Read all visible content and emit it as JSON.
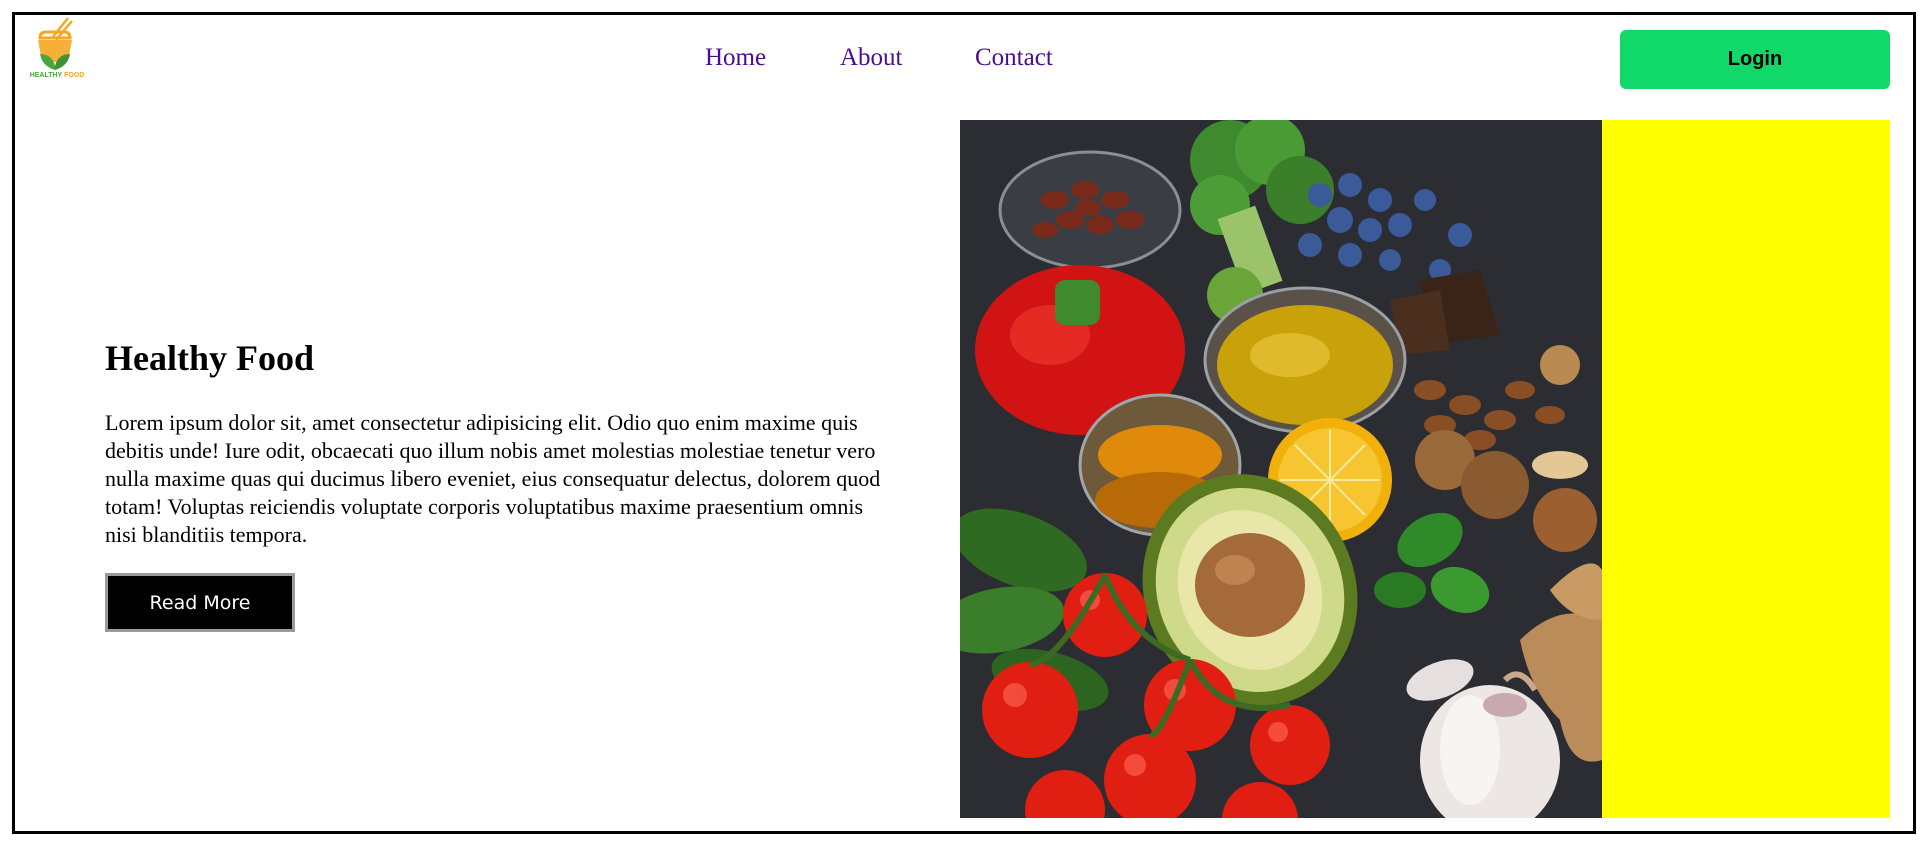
{
  "brand": {
    "logo_text_1": "HEALTHY",
    "logo_text_2": "FOOD",
    "colors": {
      "green": "#4aa63c",
      "orange": "#f5a623"
    }
  },
  "nav": {
    "items": [
      {
        "label": "Home"
      },
      {
        "label": "About"
      },
      {
        "label": "Contact"
      }
    ],
    "link_color": "#4b0d90"
  },
  "header": {
    "login_label": "Login",
    "login_color": "#10d96a"
  },
  "hero": {
    "title": "Healthy Food",
    "text": "Lorem ipsum dolor sit, amet consectetur adipisicing elit. Odio quo enim maxime quis debitis unde! Iure odit, obcaecati quo illum nobis amet molestias molestiae tenetur vero nulla maxime quas qui ducimus libero eveniet, eius consequatur delectus, dolorem quod totam! Voluptas reiciendis voluptate corporis voluptatibus maxime praesentium omnis nisi blanditiis tempora.",
    "button_label": "Read More",
    "image_icon": "healthy-food-photo",
    "panel_color": "#ffff00"
  }
}
